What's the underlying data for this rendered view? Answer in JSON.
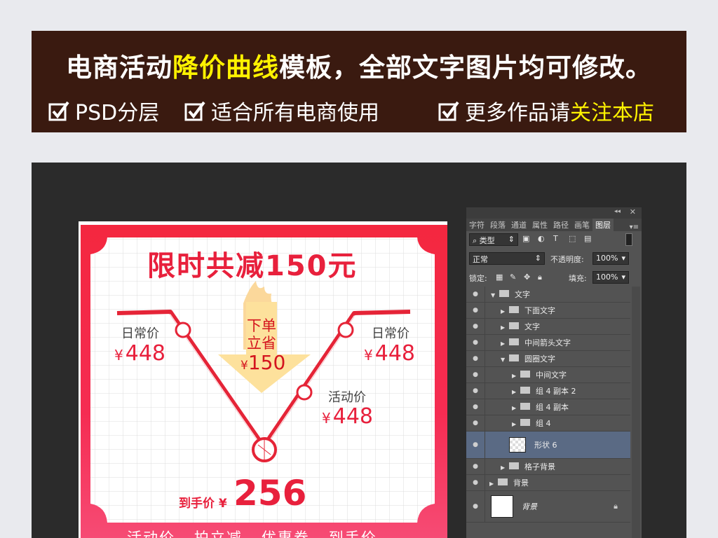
{
  "banner": {
    "title_prefix": "电商活动",
    "title_highlight": "降价曲线",
    "title_suffix": "模板，全部文字图片均可修改。",
    "features": [
      {
        "text": "PSD分层",
        "highlight": ""
      },
      {
        "text": "适合所有电商使用",
        "highlight": ""
      },
      {
        "text": "更多作品请",
        "highlight": "关注本店"
      }
    ]
  },
  "poster": {
    "title": "限时共减150元",
    "left_label": "日常价",
    "left_price": "448",
    "right_label": "日常价",
    "right_price": "448",
    "mid_label": "活动价",
    "mid_price": "448",
    "arrow_line1": "下单",
    "arrow_line2": "立省",
    "arrow_price": "150",
    "final_label": "到手价",
    "final_price": "256",
    "currency": "¥",
    "bottom_text": "活动价 - 拍立减 - 优惠券 - 到手价"
  },
  "panel": {
    "tabs": [
      "字符",
      "段落",
      "通道",
      "属性",
      "路径",
      "画笔",
      "图层"
    ],
    "active_tab": "图层",
    "filter": "类型",
    "blend_mode": "正常",
    "opacity_label": "不透明度:",
    "opacity": "100%",
    "lock_label": "锁定:",
    "fill_label": "填充:",
    "fill": "100%",
    "layers": [
      {
        "name": "文字",
        "indent": 0,
        "open": true
      },
      {
        "name": "下面文字",
        "indent": 1,
        "open": false
      },
      {
        "name": "文字",
        "indent": 1,
        "open": false
      },
      {
        "name": "中间箭头文字",
        "indent": 1,
        "open": false
      },
      {
        "name": "圆圈文字",
        "indent": 1,
        "open": true
      },
      {
        "name": "中间文字",
        "indent": 2,
        "open": false
      },
      {
        "name": "组 4 副本 2",
        "indent": 2,
        "open": false
      },
      {
        "name": "组 4 副本",
        "indent": 2,
        "open": false
      },
      {
        "name": "组 4",
        "indent": 2,
        "open": false
      },
      {
        "name": "形状 6",
        "indent": 2,
        "open": false
      },
      {
        "name": "格子背景",
        "indent": 1,
        "open": false
      },
      {
        "name": "背景",
        "indent": 0,
        "open": false
      },
      {
        "name": "背景",
        "indent": 0,
        "open": false
      }
    ]
  },
  "colors": {
    "accent": "#e8203c",
    "banner_bg": "#3a1a10",
    "highlight": "#fff200"
  }
}
